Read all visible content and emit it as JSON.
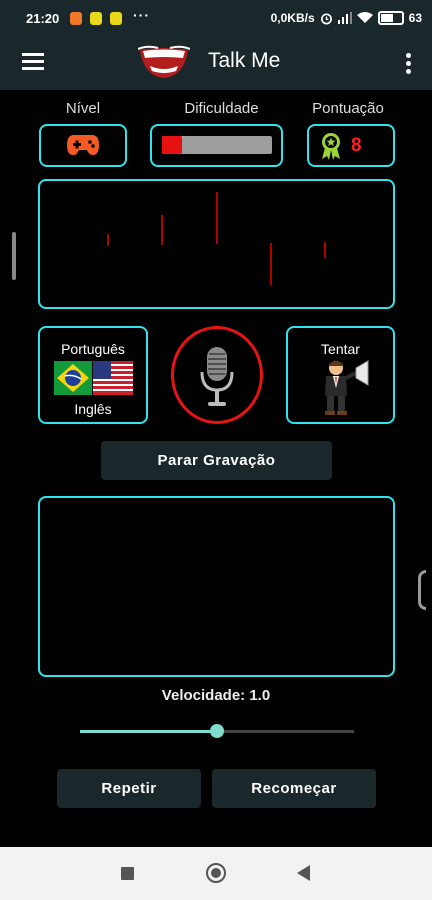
{
  "status_bar": {
    "time": "21:20",
    "more": "···",
    "network_speed": "0,0KB/s",
    "battery": "63"
  },
  "toolbar": {
    "title": "Talk Me",
    "menu_icon": "hamburger-menu-icon",
    "more_icon": "more-vert-icon",
    "logo_icon": "smiling-mouth-logo"
  },
  "labels": {
    "level": "Nível",
    "difficulty": "Dificuldade",
    "score": "Pontuação"
  },
  "level_icon": "gamepad-icon",
  "difficulty_level": 0.18,
  "score_value": "8",
  "waveform": {
    "color": "#b00000"
  },
  "language": {
    "from": "Português",
    "to": "Inglês",
    "from_flag": "brazil-flag",
    "to_flag": "usa-flag"
  },
  "mic_icon": "microphone-icon",
  "try": {
    "label": "Tentar",
    "icon": "presenter-megaphone-icon"
  },
  "buttons": {
    "stop_recording": "Parar Gravação",
    "repeat": "Repetir",
    "restart": "Recomeçar"
  },
  "speed": {
    "label": "Velocidade: 1.0",
    "value": 1.0,
    "fraction": 0.5
  },
  "colors": {
    "accent": "#2fe4ee",
    "background": "#000000",
    "bar": "#1a282c",
    "red": "#e81111",
    "slider": "#7fdccf"
  }
}
